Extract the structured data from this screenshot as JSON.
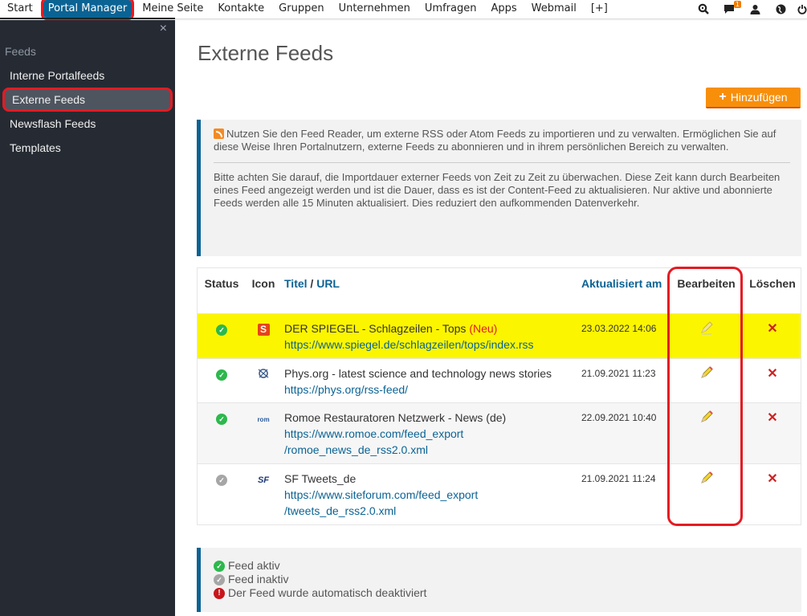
{
  "topnav": {
    "items": [
      {
        "label": "Start"
      },
      {
        "label": "Portal Manager",
        "active": true
      },
      {
        "label": "Meine Seite"
      },
      {
        "label": "Kontakte"
      },
      {
        "label": "Gruppen"
      },
      {
        "label": "Unternehmen"
      },
      {
        "label": "Umfragen"
      },
      {
        "label": "Apps"
      },
      {
        "label": "Webmail"
      },
      {
        "label": "[+]"
      }
    ],
    "icons": [
      "search-icon",
      "messages-icon",
      "user-icon",
      "globe-icon",
      "power-icon"
    ],
    "messages_badge": "1"
  },
  "sidebar": {
    "close_label": "×",
    "heading": "Feeds",
    "items": [
      {
        "label": "Interne Portalfeeds"
      },
      {
        "label": "Externe Feeds",
        "active": true
      },
      {
        "label": "Newsflash Feeds"
      },
      {
        "label": "Templates"
      }
    ]
  },
  "main": {
    "title": "Externe Feeds",
    "add_button": "Hinzufügen",
    "info": {
      "paragraph1": "Nutzen Sie den Feed Reader, um externe RSS oder Atom Feeds zu importieren und zu verwalten. Ermöglichen Sie auf diese Weise Ihren Portalnutzern, externe Feeds zu abonnieren und in ihrem persönlichen Bereich zu verwalten.",
      "paragraph2": "Bitte achten Sie darauf, die Importdauer externer Feeds von Zeit zu Zeit zu überwachen. Diese Zeit kann durch Bearbeiten eines Feed angezeigt werden und ist die Dauer, dass es ist der Content-Feed zu aktualisieren. Nur aktive und abonnierte Feeds werden alle 15 Minuten aktualisiert. Dies reduziert den aufkommenden Datenverkehr."
    },
    "table": {
      "headers": {
        "status": "Status",
        "icon": "Icon",
        "title": "Titel",
        "title_sep": " / ",
        "url": "URL",
        "updated": "Aktualisiert am",
        "edit": "Bearbeiten",
        "delete": "Löschen"
      },
      "rows": [
        {
          "status": "active",
          "icon": "spiegel-icon",
          "icon_text": "S",
          "title": "DER SPIEGEL - Schlagzeilen - Tops",
          "new_label": "(Neu)",
          "url1": "https://www.spiegel.de/schlagzeilen/tops/index.rss",
          "url2": "",
          "updated": "23.03.2022 14:06",
          "highlight": true
        },
        {
          "status": "active",
          "icon": "physorg-icon",
          "icon_text": "",
          "title": "Phys.org - latest science and technology news stories",
          "new_label": "",
          "url1": "https://phys.org/rss-feed/",
          "url2": "",
          "updated": "21.09.2021 11:23"
        },
        {
          "status": "active",
          "icon": "romoe-icon",
          "icon_text": "rom",
          "title": "Romoe Restauratoren Netzwerk - News (de)",
          "new_label": "",
          "url1": "https://www.romoe.com/feed_export",
          "url2": "/romoe_news_de_rss2.0.xml",
          "updated": "22.09.2021 10:40"
        },
        {
          "status": "inactive",
          "icon": "siteforum-icon",
          "icon_text": "SF",
          "title": "SF Tweets_de",
          "new_label": "",
          "url1": "https://www.siteforum.com/feed_export",
          "url2": "/tweets_de_rss2.0.xml",
          "updated": "21.09.2021 11:24"
        }
      ]
    },
    "legend": {
      "active": "Feed aktiv",
      "inactive": "Feed inaktiv",
      "deactivated": "Der Feed wurde automatisch deaktiviert"
    }
  },
  "colors": {
    "brand_blue": "#0b6394",
    "accent_orange": "#f78f0b",
    "highlight_yellow": "#fcf500",
    "annotation_red": "#e41b23",
    "sidebar_bg": "#262b33"
  }
}
